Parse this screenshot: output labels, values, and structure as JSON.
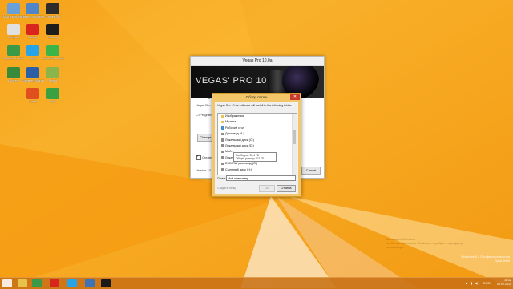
{
  "desktop": {
    "icons": [
      {
        "label": "Мой компьютер",
        "icon": "computer-icon",
        "color": "#6aa0d8"
      },
      {
        "label": "Панель управления",
        "icon": "control-panel-icon",
        "color": "#4f86c9"
      },
      {
        "label": "Games Rel",
        "icon": "game-icon",
        "color": "#2c2c2c"
      },
      {
        "label": "Корзина",
        "icon": "recycle-bin-icon",
        "color": "#e0e0e0"
      },
      {
        "label": "Yandex",
        "icon": "yandex-icon",
        "color": "#d8261e"
      },
      {
        "label": "Winamp",
        "icon": "winamp-icon",
        "color": "#1d1d1d"
      },
      {
        "label": "Google Chrome",
        "icon": "chrome-icon",
        "color": "#3a9a48"
      },
      {
        "label": "Skype",
        "icon": "skype-icon",
        "color": "#27a4e8"
      },
      {
        "label": "Встроенный эквалайзер",
        "icon": "equalizer-icon",
        "color": "#3bb44a"
      },
      {
        "label": "uTorrent",
        "icon": "utorrent-icon",
        "color": "#3a8a3c"
      },
      {
        "label": "Документ Microsoft",
        "icon": "document-icon",
        "color": "#2b5fa8"
      },
      {
        "label": "Media",
        "icon": "media-icon",
        "color": "#8bb54a"
      },
      {
        "label": "Avast",
        "icon": "avast-icon",
        "color": "#e0501f"
      },
      {
        "label": "Tree",
        "icon": "tree-icon",
        "color": "#3aa142"
      }
    ]
  },
  "installer": {
    "title": "Vegas Pro 10.0a",
    "brand": "VEGAS' PRO 10",
    "heading": "Configu",
    "line1": "Vegas Pro 10",
    "path": "C:\\Program",
    "change_label": "Change...",
    "checkbox_label": "Create a",
    "version": "Version 10.0",
    "cancel_label": "Cancel"
  },
  "dialog": {
    "title": "Обзор папок",
    "description": "Vegas Pro 10.0a software will install to the following folder:",
    "folders": [
      {
        "label": "Изображения",
        "kind": "folder"
      },
      {
        "label": "Музыка",
        "kind": "folder"
      },
      {
        "label": "Рабочий стол",
        "kind": "blue"
      },
      {
        "label": "Дисковод (A:)",
        "kind": "drive"
      },
      {
        "label": "Локальный диск (C:)",
        "kind": "drive"
      },
      {
        "label": "Локальный диск (D:)",
        "kind": "drive"
      },
      {
        "label": "Мой...",
        "kind": "drive"
      },
      {
        "label": "Локал...",
        "kind": "drive"
      },
      {
        "label": "DVD RW дисковод (G:)",
        "kind": "drive"
      },
      {
        "label": "Съемный диск (H:)",
        "kind": "drive"
      }
    ],
    "tooltip_line1": "Свободно: 33,4 ГБ",
    "tooltip_line2": "Общий размер: 111 ГБ",
    "folder_label": "Папка:",
    "folder_value": "Мой компьютер",
    "make_folder_label": "Создать папку",
    "ok_label": "ОК",
    "cancel_label": "Отмена"
  },
  "watermark": {
    "line1": "Активация Windows",
    "line2": "Чтобы активировать Windows, перейдите к разделу",
    "line3": "компьютера."
  },
  "os": {
    "edition": "Windows 8.1 Профессиональная",
    "build": "Build 9600"
  },
  "taskbar": {
    "language": "ENG",
    "time": "18:32",
    "date": "09.02.2015",
    "buttons": [
      {
        "name": "explorer-icon",
        "color": "#e8c14a"
      },
      {
        "name": "chrome-icon",
        "color": "#3a9a48"
      },
      {
        "name": "yandex-icon",
        "color": "#d8261e"
      },
      {
        "name": "skype-icon",
        "color": "#27a4e8"
      },
      {
        "name": "media-player-icon",
        "color": "#3f73b8"
      },
      {
        "name": "vegas-icon",
        "color": "#1a1a1a"
      }
    ]
  },
  "colors": {
    "desktop_bg": "#f6a31a",
    "dialog_frame": "#f4c66a",
    "close": "#c93b2b"
  }
}
